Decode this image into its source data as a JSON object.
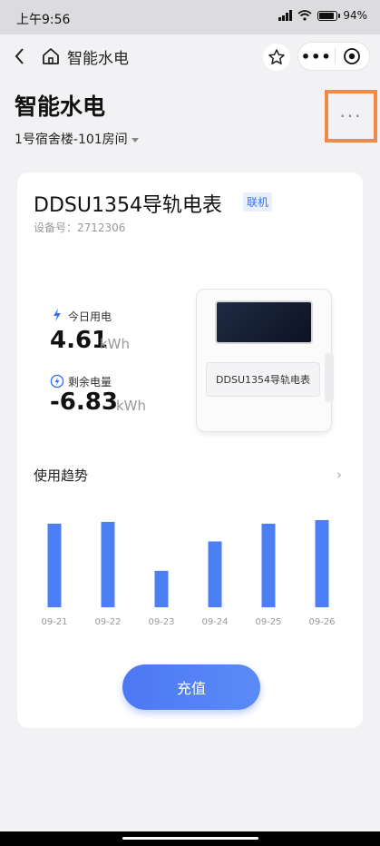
{
  "status_bar": {
    "time": "上午9:56",
    "battery": "94%",
    "battery_level": 0.94
  },
  "nav": {
    "title": "智能水电"
  },
  "page": {
    "title": "智能水电",
    "location": "1号宿舍楼-101房间",
    "more": "···"
  },
  "device": {
    "name": "DDSU1354导轨电表",
    "status": "联机",
    "id_label": "设备号：2712306",
    "image_label": "DDSU1354导轨电表"
  },
  "stats": {
    "today": {
      "label": "今日用电",
      "value": "4.61",
      "unit": "kWh"
    },
    "remaining": {
      "label": "剩余电量",
      "value": "-6.83",
      "unit": "kWh"
    }
  },
  "trend": {
    "title": "使用趋势",
    "arrow": "›"
  },
  "chart_data": {
    "type": "bar",
    "categories": [
      "09-21",
      "09-22",
      "09-23",
      "09-24",
      "09-25",
      "09-26"
    ],
    "values": [
      0.94,
      0.96,
      0.41,
      0.74,
      0.94,
      0.98
    ],
    "color": "#4c7ef5"
  },
  "actions": {
    "recharge": "充值"
  },
  "colors": {
    "accent": "#4c78f4",
    "highlight_box": "#f08a4b"
  }
}
